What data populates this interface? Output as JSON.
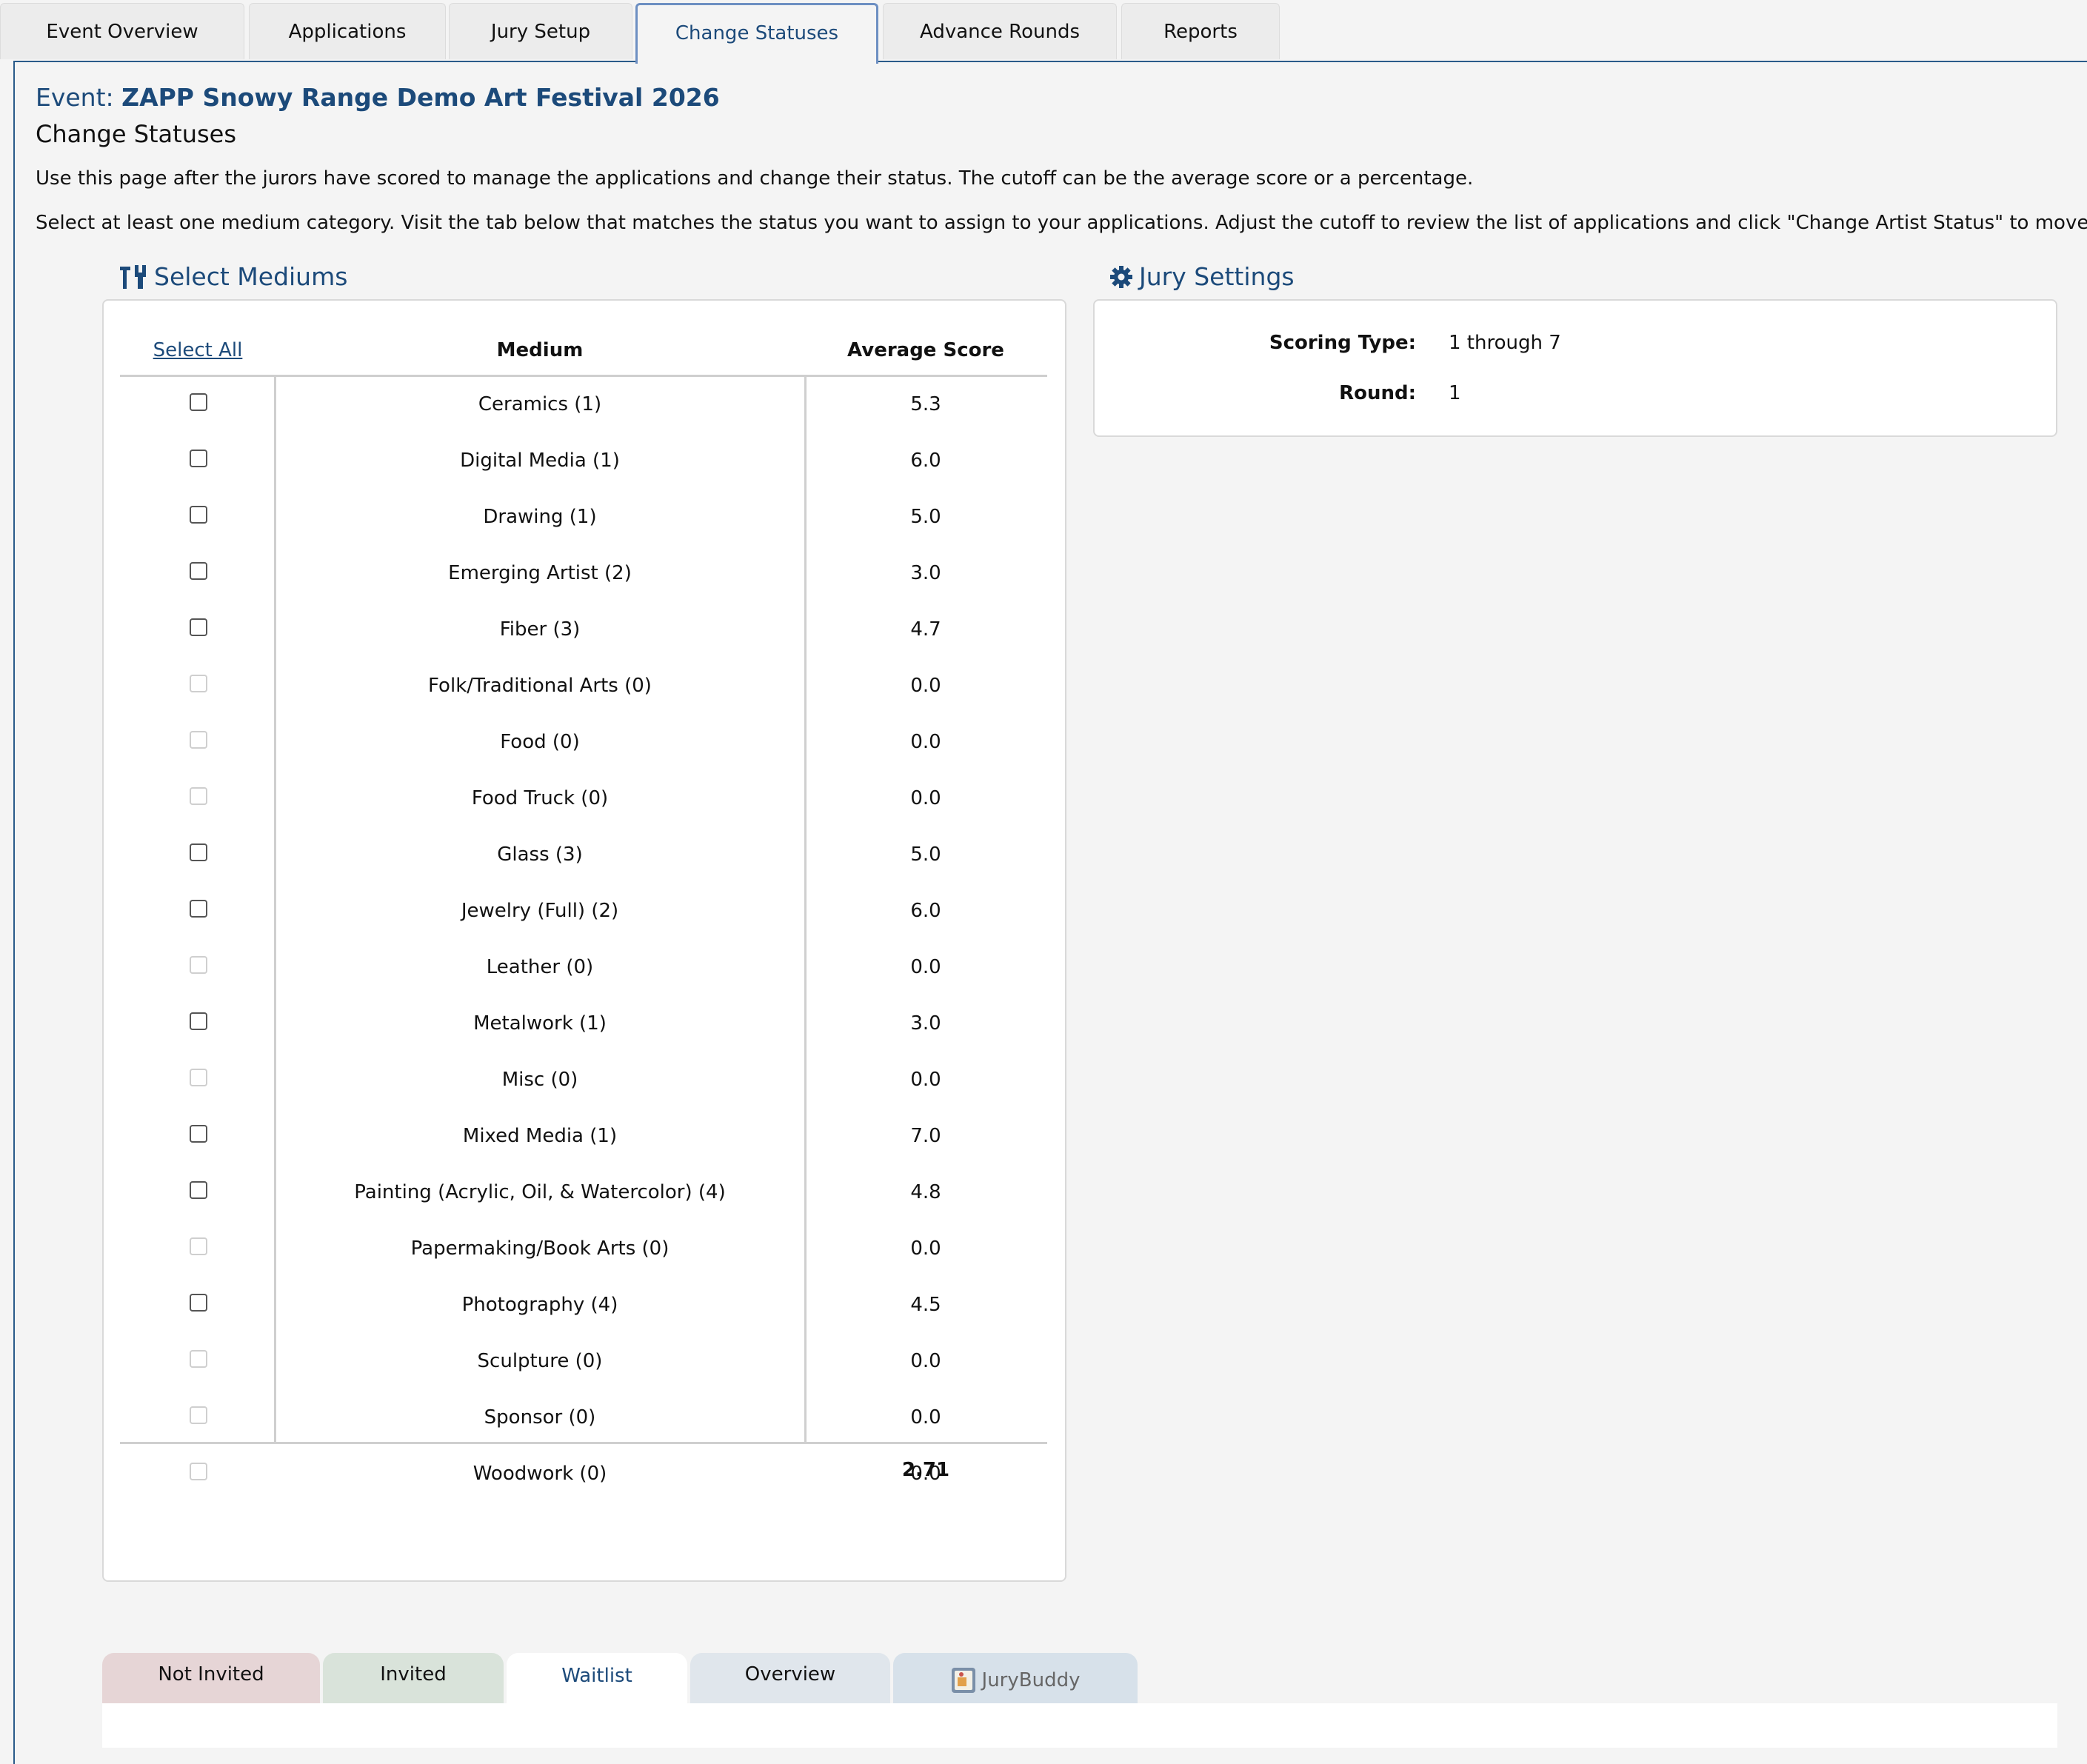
{
  "top_tabs": [
    {
      "label": "Event Overview"
    },
    {
      "label": "Applications"
    },
    {
      "label": "Jury Setup"
    },
    {
      "label": "Change Statuses",
      "active": true
    },
    {
      "label": "Advance Rounds"
    },
    {
      "label": "Reports"
    }
  ],
  "event": {
    "prefix": "Event:",
    "name": "ZAPP Snowy Range Demo Art Festival 2026"
  },
  "page_title": "Change Statuses",
  "instructions": [
    "Use this page after the jurors have scored to manage the applications and change their status. The cutoff can be the average score or a percentage.",
    "Select at least one medium category. Visit the tab below that matches the status you want to assign to your applications. Adjust the cutoff to review the list of applications and click \"Change Artist Status\" to move them."
  ],
  "mediums_section": {
    "title": "Select Mediums",
    "icon": "tools-icon",
    "select_all": "Select All",
    "col_medium": "Medium",
    "col_score": "Average Score",
    "rows": [
      {
        "medium": "Ceramics (1)",
        "score": "5.3",
        "enabled": true
      },
      {
        "medium": "Digital Media (1)",
        "score": "6.0",
        "enabled": true
      },
      {
        "medium": "Drawing (1)",
        "score": "5.0",
        "enabled": true
      },
      {
        "medium": "Emerging Artist (2)",
        "score": "3.0",
        "enabled": true
      },
      {
        "medium": "Fiber (3)",
        "score": "4.7",
        "enabled": true
      },
      {
        "medium": "Folk/Traditional Arts (0)",
        "score": "0.0",
        "enabled": false
      },
      {
        "medium": "Food (0)",
        "score": "0.0",
        "enabled": false
      },
      {
        "medium": "Food Truck (0)",
        "score": "0.0",
        "enabled": false
      },
      {
        "medium": "Glass (3)",
        "score": "5.0",
        "enabled": true
      },
      {
        "medium": "Jewelry (Full) (2)",
        "score": "6.0",
        "enabled": true
      },
      {
        "medium": "Leather (0)",
        "score": "0.0",
        "enabled": false
      },
      {
        "medium": "Metalwork (1)",
        "score": "3.0",
        "enabled": true
      },
      {
        "medium": "Misc (0)",
        "score": "0.0",
        "enabled": false
      },
      {
        "medium": "Mixed Media (1)",
        "score": "7.0",
        "enabled": true
      },
      {
        "medium": "Painting (Acrylic, Oil, & Watercolor) (4)",
        "score": "4.8",
        "enabled": true
      },
      {
        "medium": "Papermaking/Book Arts (0)",
        "score": "0.0",
        "enabled": false
      },
      {
        "medium": "Photography (4)",
        "score": "4.5",
        "enabled": true
      },
      {
        "medium": "Sculpture (0)",
        "score": "0.0",
        "enabled": false
      },
      {
        "medium": "Sponsor (0)",
        "score": "0.0",
        "enabled": false
      },
      {
        "medium": "Woodwork (0)",
        "score": "0.0",
        "enabled": false
      }
    ],
    "total": "2.71"
  },
  "jury_settings": {
    "title": "Jury Settings",
    "icon": "gear-icon",
    "scoring_type_label": "Scoring Type:",
    "scoring_type_value": "1 through 7",
    "round_label": "Round:",
    "round_value": "1"
  },
  "status_tabs": [
    {
      "label": "Not Invited",
      "color": "#e6d5d6"
    },
    {
      "label": "Invited",
      "color": "#d9e3da"
    },
    {
      "label": "Waitlist",
      "color": "#ffffff",
      "active": true
    },
    {
      "label": "Overview",
      "color": "#e0e6ec"
    },
    {
      "label": "JuryBuddy",
      "color": "#d7e1ea",
      "icon": "jurybuddy-icon"
    }
  ]
}
